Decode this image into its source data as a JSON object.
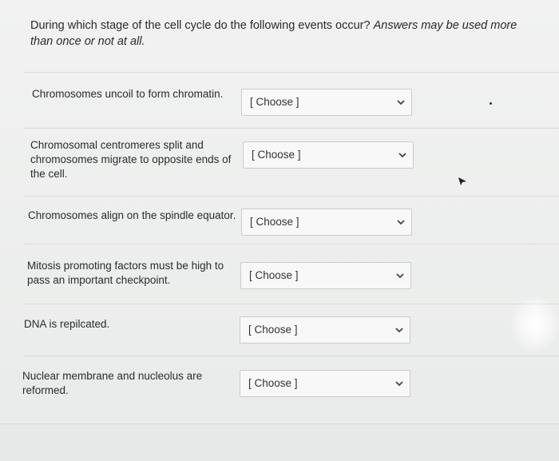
{
  "question": {
    "text": "During which stage of the cell cycle do the following events occur?",
    "note": "Answers may be used more than once or not at all."
  },
  "items": [
    {
      "label": "Chromosomes uncoil to form chromatin.",
      "selected": "[ Choose ]"
    },
    {
      "label": "Chromosomal centromeres split and chromosomes migrate to opposite ends of the cell.",
      "selected": "[ Choose ]"
    },
    {
      "label": "Chromosomes align on the spindle equator.",
      "selected": "[ Choose ]"
    },
    {
      "label": "Mitosis promoting factors must be high to pass an important checkpoint.",
      "selected": "[ Choose ]"
    },
    {
      "label": "DNA is repilcated.",
      "selected": "[ Choose ]"
    },
    {
      "label": "Nuclear membrane and nucleolus are reformed.",
      "selected": "[ Choose ]"
    }
  ],
  "icons": {
    "dropdown": "chevron-down-icon"
  }
}
